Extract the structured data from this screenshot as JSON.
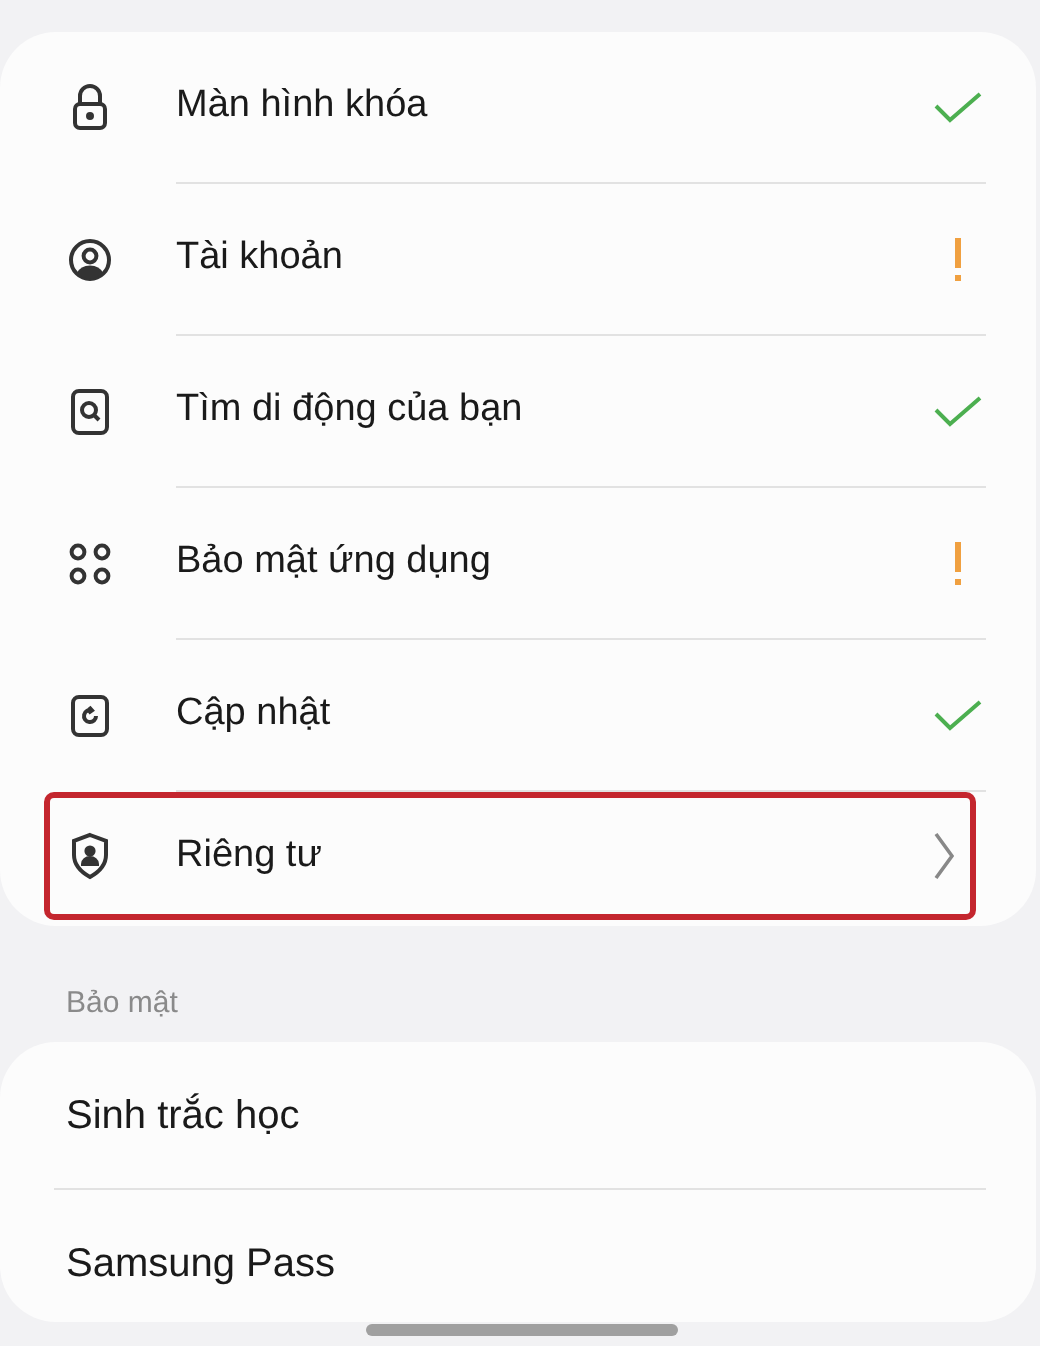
{
  "items": [
    {
      "label": "Màn hình khóa",
      "kind": "check",
      "highlighted": false
    },
    {
      "label": "Tài khoản",
      "kind": "warning",
      "highlighted": false
    },
    {
      "label": "Tìm di động của bạn",
      "kind": "check",
      "highlighted": false
    },
    {
      "label": "Bảo mật ứng dụng",
      "kind": "warning",
      "highlighted": false
    },
    {
      "label": "Cập nhật",
      "kind": "check",
      "highlighted": false
    },
    {
      "label": "Riêng tư",
      "kind": "chevron",
      "highlighted": true
    }
  ],
  "section": {
    "title": "Bảo mật",
    "items": [
      {
        "label": "Sinh trắc học"
      },
      {
        "label": "Samsung Pass"
      }
    ]
  }
}
